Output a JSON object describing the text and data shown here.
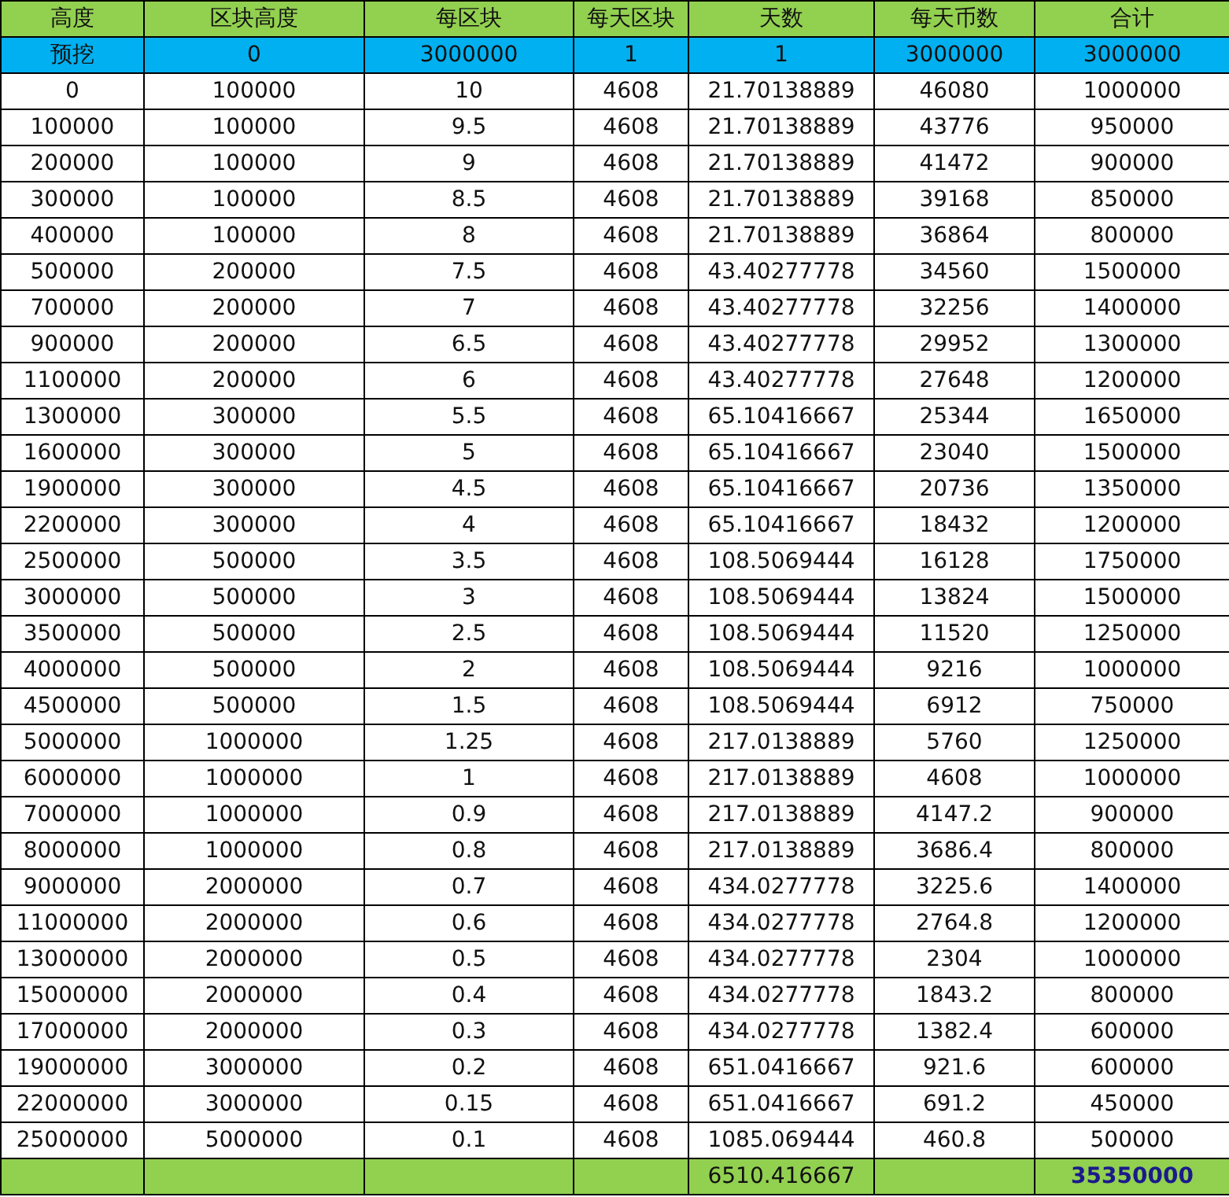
{
  "columns": [
    "高度",
    "区块高度",
    "每区块",
    "每天区块",
    "天数",
    "每天币数",
    "合计"
  ],
  "preset_row": [
    "预挖",
    "0",
    "3000000",
    "1",
    "1",
    "3000000",
    "3000000"
  ],
  "rows": [
    [
      "0",
      "100000",
      "10",
      "4608",
      "21.70138889",
      "46080",
      "1000000"
    ],
    [
      "100000",
      "100000",
      "9.5",
      "4608",
      "21.70138889",
      "43776",
      "950000"
    ],
    [
      "200000",
      "100000",
      "9",
      "4608",
      "21.70138889",
      "41472",
      "900000"
    ],
    [
      "300000",
      "100000",
      "8.5",
      "4608",
      "21.70138889",
      "39168",
      "850000"
    ],
    [
      "400000",
      "100000",
      "8",
      "4608",
      "21.70138889",
      "36864",
      "800000"
    ],
    [
      "500000",
      "200000",
      "7.5",
      "4608",
      "43.40277778",
      "34560",
      "1500000"
    ],
    [
      "700000",
      "200000",
      "7",
      "4608",
      "43.40277778",
      "32256",
      "1400000"
    ],
    [
      "900000",
      "200000",
      "6.5",
      "4608",
      "43.40277778",
      "29952",
      "1300000"
    ],
    [
      "1100000",
      "200000",
      "6",
      "4608",
      "43.40277778",
      "27648",
      "1200000"
    ],
    [
      "1300000",
      "300000",
      "5.5",
      "4608",
      "65.10416667",
      "25344",
      "1650000"
    ],
    [
      "1600000",
      "300000",
      "5",
      "4608",
      "65.10416667",
      "23040",
      "1500000"
    ],
    [
      "1900000",
      "300000",
      "4.5",
      "4608",
      "65.10416667",
      "20736",
      "1350000"
    ],
    [
      "2200000",
      "300000",
      "4",
      "4608",
      "65.10416667",
      "18432",
      "1200000"
    ],
    [
      "2500000",
      "500000",
      "3.5",
      "4608",
      "108.5069444",
      "16128",
      "1750000"
    ],
    [
      "3000000",
      "500000",
      "3",
      "4608",
      "108.5069444",
      "13824",
      "1500000"
    ],
    [
      "3500000",
      "500000",
      "2.5",
      "4608",
      "108.5069444",
      "11520",
      "1250000"
    ],
    [
      "4000000",
      "500000",
      "2",
      "4608",
      "108.5069444",
      "9216",
      "1000000"
    ],
    [
      "4500000",
      "500000",
      "1.5",
      "4608",
      "108.5069444",
      "6912",
      "750000"
    ],
    [
      "5000000",
      "1000000",
      "1.25",
      "4608",
      "217.0138889",
      "5760",
      "1250000"
    ],
    [
      "6000000",
      "1000000",
      "1",
      "4608",
      "217.0138889",
      "4608",
      "1000000"
    ],
    [
      "7000000",
      "1000000",
      "0.9",
      "4608",
      "217.0138889",
      "4147.2",
      "900000"
    ],
    [
      "8000000",
      "1000000",
      "0.8",
      "4608",
      "217.0138889",
      "3686.4",
      "800000"
    ],
    [
      "9000000",
      "2000000",
      "0.7",
      "4608",
      "434.0277778",
      "3225.6",
      "1400000"
    ],
    [
      "11000000",
      "2000000",
      "0.6",
      "4608",
      "434.0277778",
      "2764.8",
      "1200000"
    ],
    [
      "13000000",
      "2000000",
      "0.5",
      "4608",
      "434.0277778",
      "2304",
      "1000000"
    ],
    [
      "15000000",
      "2000000",
      "0.4",
      "4608",
      "434.0277778",
      "1843.2",
      "800000"
    ],
    [
      "17000000",
      "2000000",
      "0.3",
      "4608",
      "434.0277778",
      "1382.4",
      "600000"
    ],
    [
      "19000000",
      "3000000",
      "0.2",
      "4608",
      "651.0416667",
      "921.6",
      "600000"
    ],
    [
      "22000000",
      "3000000",
      "0.15",
      "4608",
      "651.0416667",
      "691.2",
      "450000"
    ],
    [
      "25000000",
      "5000000",
      "0.1",
      "4608",
      "1085.069444",
      "460.8",
      "500000"
    ]
  ],
  "total_row": {
    "days_total": "6510.416667",
    "coins_total": "35350000"
  }
}
